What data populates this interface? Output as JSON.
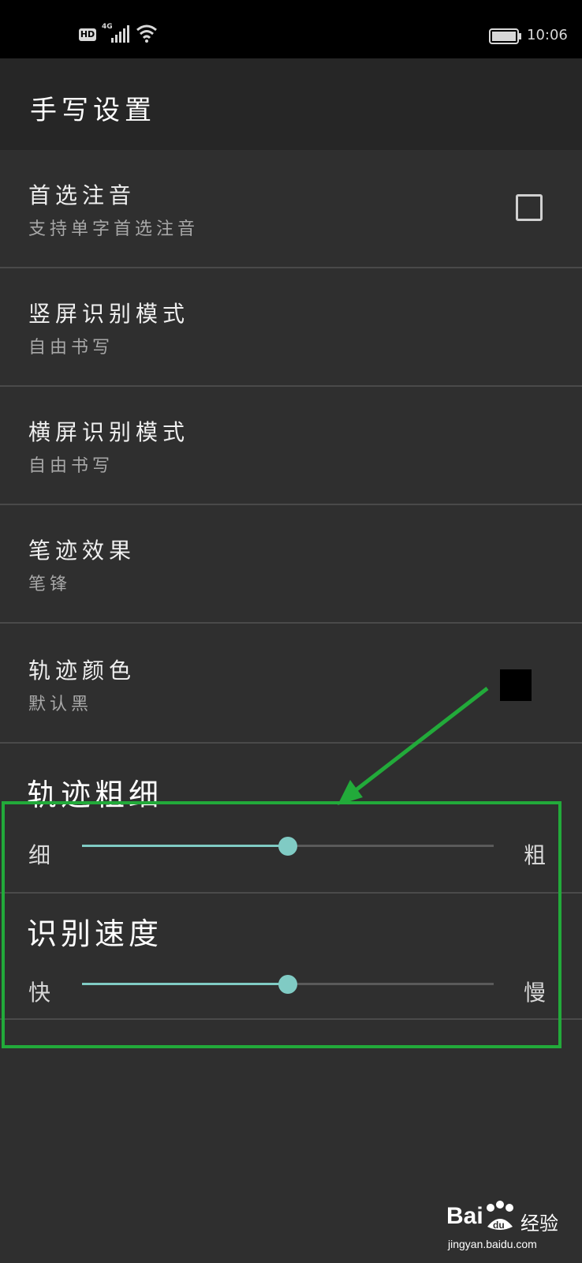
{
  "status_bar": {
    "hd_badge": "HD",
    "network": "4G",
    "time": "10:06",
    "icons": [
      "signal-icon",
      "wifi-icon",
      "battery-icon"
    ]
  },
  "app_bar": {
    "title": "手写设置"
  },
  "preferences": [
    {
      "title": "首选注音",
      "summary": "支持单字首选注音",
      "control": "checkbox",
      "checked": false
    },
    {
      "title": "竖屏识别模式",
      "summary": "自由书写"
    },
    {
      "title": "横屏识别模式",
      "summary": "自由书写"
    },
    {
      "title": "笔迹效果",
      "summary": "笔锋"
    },
    {
      "title": "轨迹颜色",
      "summary": "默认黑",
      "control": "color-swatch",
      "color": "#000000"
    }
  ],
  "stroke_width": {
    "title": "轨迹粗细",
    "min_label": "细",
    "max_label": "粗",
    "value_fraction": 0.5
  },
  "recognition_speed": {
    "title": "识别速度",
    "min_label": "快",
    "max_label": "慢",
    "value_fraction": 0.5
  },
  "colors": {
    "background": "#2f2f2f",
    "app_bar": "#262626",
    "accent": "#80cbc4",
    "annotation": "#22aa3a"
  },
  "watermark": {
    "brand": "Bai",
    "brand_suffix": "du",
    "cn": "经验",
    "url": "jingyan.baidu.com"
  }
}
